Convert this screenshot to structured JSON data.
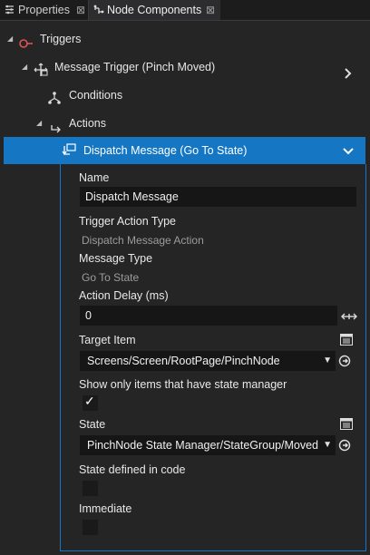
{
  "tabs": {
    "properties": {
      "label": "Properties",
      "close": "⊠"
    },
    "node_components": {
      "label": "Node Components",
      "close": "⊠"
    }
  },
  "tree": {
    "triggers": "Triggers",
    "message_trigger": "Message Trigger (Pinch Moved)",
    "conditions": "Conditions",
    "actions": "Actions",
    "dispatch": "Dispatch Message (Go To State)"
  },
  "fields": {
    "name_label": "Name",
    "name_value": "Dispatch Message",
    "trigger_action_type_label": "Trigger Action Type",
    "trigger_action_type_value": "Dispatch Message Action",
    "message_type_label": "Message Type",
    "message_type_value": "Go To State",
    "action_delay_label": "Action Delay (ms)",
    "action_delay_value": "0",
    "target_item_label": "Target Item",
    "target_item_value": "Screens/Screen/RootPage/PinchNode",
    "show_only_label": "Show only items that have state manager",
    "show_only_checked": true,
    "state_label": "State",
    "state_value": "PinchNode State Manager/StateGroup/Moved",
    "state_in_code_label": "State defined in code",
    "state_in_code_checked": false,
    "immediate_label": "Immediate",
    "immediate_checked": false
  },
  "colors": {
    "selection": "#1577c4",
    "triggers_icon": "#e05252",
    "background": "#252526"
  },
  "icons": {
    "properties_tab": "sliders-icon",
    "node_components_tab": "node-components-icon",
    "triggers": "trigger-link-icon",
    "message_trigger": "message-trigger-icon",
    "conditions": "conditions-tree-icon",
    "actions": "actions-arrow-icon",
    "dispatch": "dispatch-message-icon"
  }
}
